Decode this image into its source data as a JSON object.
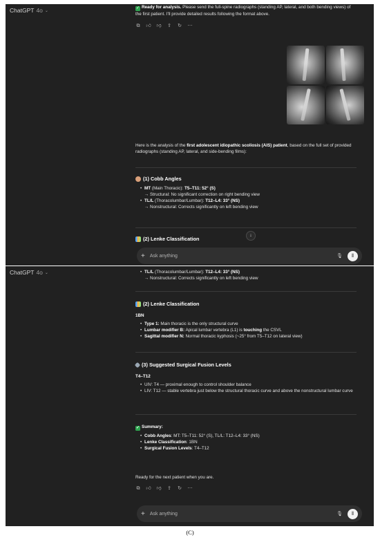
{
  "app": {
    "name": "ChatGPT",
    "model": "4o"
  },
  "top": {
    "ready_bold": "Ready for analysis.",
    "ready_text": " Please send the full-spine radiographs (standing AP, lateral, and both bending views) of the first patient. I'll provide detailed results following the format above.",
    "intro_pre": "Here is the analysis of the ",
    "intro_bold": "first adolescent idiopathic scoliosis (AIS) patient",
    "intro_post": ", based on the full set of provided radiographs (standing AP, lateral, and side-bending films):",
    "cobb_title": "(1) Cobb Angles",
    "mt_label": "MT",
    "mt_paren": " (Main Thoracic): ",
    "mt_value": "T5–T11: 52° (S)",
    "mt_note": "→ Structural: No significant correction on right bending view",
    "tl_label": "TL/L",
    "tl_paren": " (Thoracolumbar/Lumbar): ",
    "tl_value": "T12–L4: 33° (NS)",
    "tl_note": "→ Nonstructural: Corrects significantly on left bending view",
    "lenke_title": "(2) Lenke Classification"
  },
  "bottom": {
    "tl_label": "TL/L",
    "tl_paren": " (Thoracolumbar/Lumbar): ",
    "tl_value": "T12–L4: 33° (NS)",
    "tl_note": "→ Nonstructural: Corrects significantly on left bending view",
    "lenke_title": "(2) Lenke Classification",
    "lenke_code": "1BN",
    "type_label": "Type 1:",
    "type_text": " Main thoracic is the only structural curve",
    "lumbar_label": "Lumbar modifier B:",
    "lumbar_text_pre": " Apical lumbar vertebra (L1) is ",
    "lumbar_text_bold": "touching",
    "lumbar_text_post": " the CSVL",
    "sagittal_label": "Sagittal modifier N:",
    "sagittal_text": " Normal thoracic kyphosis (~25° from T5–T12 on lateral view)",
    "fusion_title": "(3) Suggested Surgical Fusion Levels",
    "fusion_range": "T4–T12",
    "uiv_text": "UIV: T4 — proximal enough to control shoulder balance",
    "liv_text": "LIV: T12 — stable vertebra just below the structural thoracic curve and above the nonstructural lumbar curve",
    "summary_title": "Summary:",
    "sum_cobb_label": "Cobb Angles",
    "sum_cobb_text": ": MT: T5–T11: 52° (S), TL/L: T12–L4: 33° (NS)",
    "sum_lenke_label": "Lenke Classification",
    "sum_lenke_text": ": 1BN",
    "sum_fusion_label": "Surgical Fusion Levels",
    "sum_fusion_text": ": T4–T12",
    "closing": "Ready for the next patient when you are."
  },
  "composer": {
    "placeholder": "Ask anything"
  },
  "caption": "(C)",
  "icons": [
    "copy-icon",
    "thumbs-up-icon",
    "thumbs-down-icon",
    "share-icon",
    "regenerate-icon",
    "more-icon",
    "plus-icon",
    "mic-icon",
    "voice-icon",
    "scroll-down-icon"
  ],
  "colors": {
    "background": "#212121",
    "composer": "#303030",
    "accent_green": "#2ea44f"
  }
}
